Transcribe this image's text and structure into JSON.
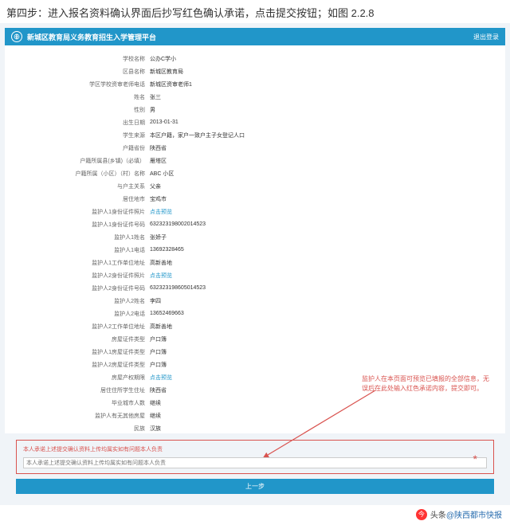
{
  "step_text": "第四步：进入报名资料确认界面后抄写红色确认承诺，点击提交按钮；如图 2.2.8",
  "header": {
    "title": "新城区教育局义务教育招生入学管理平台",
    "right": "退出登录"
  },
  "rows": [
    {
      "label": "学校名称",
      "value": "公办C学小"
    },
    {
      "label": "区县名称",
      "value": "新城区教育局"
    },
    {
      "label": "学区学校资审老师电话",
      "value": "新城区资审老师1"
    },
    {
      "label": "姓名",
      "value": "张三"
    },
    {
      "label": "性别",
      "value": "男"
    },
    {
      "label": "出生日期",
      "value": "2013-01-31"
    },
    {
      "label": "学生来源",
      "value": "本区户籍，家户一致户主子女登记人口"
    },
    {
      "label": "户籍省份",
      "value": "陕西省"
    },
    {
      "label": "户籍所属县(乡镇)（必填）",
      "value": "雁塔区"
    },
    {
      "label": "户籍所属（小区）（村）名称",
      "value": "ABC 小区"
    },
    {
      "label": "与户主关系",
      "value": "父亲"
    },
    {
      "label": "居住地市",
      "value": "宝鸡市"
    },
    {
      "label": "监护人1身份证件照片",
      "value": "点击预览",
      "link": true
    },
    {
      "label": "监护人1身份证件号码",
      "value": "632323198002014523"
    },
    {
      "label": "监护人1姓名",
      "value": "张娇子"
    },
    {
      "label": "监护人1电话",
      "value": "13692328465"
    },
    {
      "label": "监护人1工作单位地址",
      "value": "高新善地"
    },
    {
      "label": "监护人2身份证件照片",
      "value": "点击预览",
      "link": true
    },
    {
      "label": "监护人2身份证件号码",
      "value": "632323198605014523"
    },
    {
      "label": "监护人2姓名",
      "value": "李四"
    },
    {
      "label": "监护人2电话",
      "value": "13652469663"
    },
    {
      "label": "监护人2工作单位地址",
      "value": "高新善地"
    },
    {
      "label": "房屋证件类型",
      "value": "户口簿"
    },
    {
      "label": "监护人1房屋证件类型",
      "value": "户口簿"
    },
    {
      "label": "监护人2房屋证件类型",
      "value": "户口簿"
    },
    {
      "label": "房屋产权期限",
      "value": "点击预览",
      "link": true
    },
    {
      "label": "居住住所学生住址",
      "value": "陕西省"
    },
    {
      "label": "毕业城市人数",
      "value": "继续"
    },
    {
      "label": "监护人有无其他房屋",
      "value": "继续"
    },
    {
      "label": "民族",
      "value": "汉族"
    }
  ],
  "commit": {
    "title": "本人承诺上述提交确认资料上传均属实如有问题本人负责",
    "placeholder": "本人承诺上述提交确认资料上传均属实如有问题本人负责"
  },
  "annot": "监护人在本页面可预览已填报的全部信息，无误后在此处输入红色承诺内容，提交即可。",
  "submit": "上一步",
  "footer": {
    "brand": "头条",
    "at": "@陕西都市快报"
  }
}
